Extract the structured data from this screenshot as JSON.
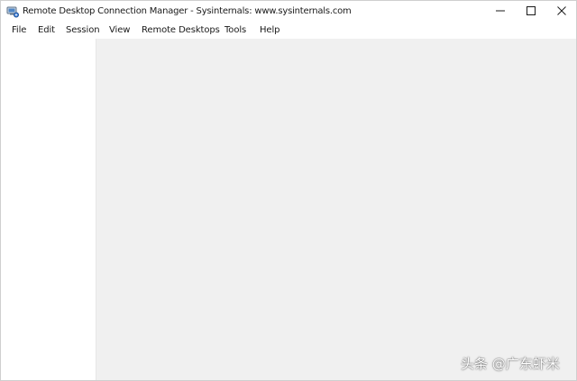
{
  "window": {
    "title": "Remote Desktop Connection Manager - Sysinternals: www.sysinternals.com",
    "app_icon": "rdcman-app-icon",
    "controls": {
      "minimize_icon": "minimize-icon",
      "maximize_icon": "maximize-icon",
      "close_icon": "close-icon"
    }
  },
  "menubar": {
    "items": [
      {
        "label": "File"
      },
      {
        "label": "Edit"
      },
      {
        "label": "Session"
      },
      {
        "label": "View"
      },
      {
        "label": "Remote Desktops"
      },
      {
        "label": "Tools"
      },
      {
        "label": "Help"
      }
    ]
  },
  "colors": {
    "main_background": "#f0f0f0",
    "sidebar_background": "#ffffff",
    "titlebar_background": "#ffffff"
  },
  "watermark": {
    "text": "头条 @广东虾米"
  }
}
